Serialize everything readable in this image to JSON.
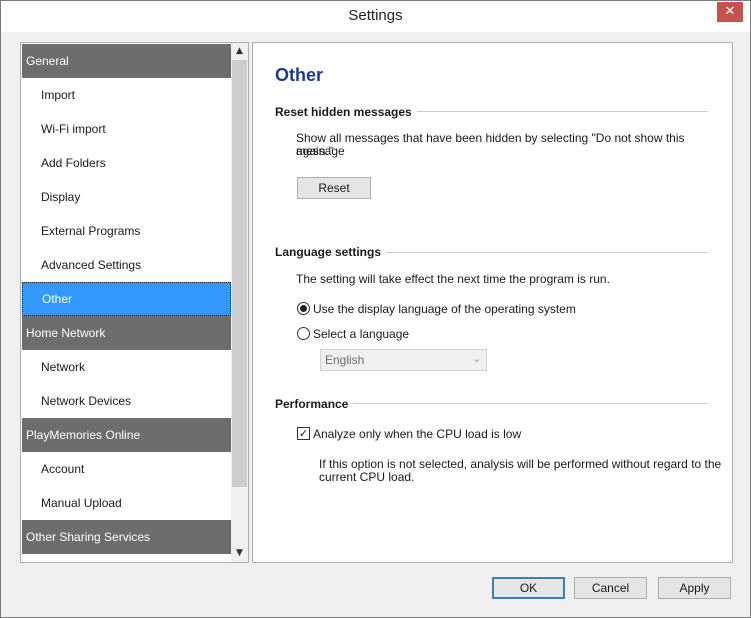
{
  "window": {
    "title": "Settings",
    "close_glyph": "✕"
  },
  "nav": {
    "items": [
      {
        "label": "General",
        "kind": "section"
      },
      {
        "label": "Import",
        "kind": "item"
      },
      {
        "label": "Wi-Fi import",
        "kind": "item"
      },
      {
        "label": "Add Folders",
        "kind": "item"
      },
      {
        "label": "Display",
        "kind": "item"
      },
      {
        "label": "External Programs",
        "kind": "item"
      },
      {
        "label": "Advanced Settings",
        "kind": "item"
      },
      {
        "label": "Other",
        "kind": "selected"
      },
      {
        "label": "Home Network",
        "kind": "section"
      },
      {
        "label": "Network",
        "kind": "item"
      },
      {
        "label": "Network Devices",
        "kind": "item"
      },
      {
        "label": "PlayMemories Online",
        "kind": "section"
      },
      {
        "label": "Account",
        "kind": "item"
      },
      {
        "label": "Manual Upload",
        "kind": "item"
      },
      {
        "label": "Other Sharing Services",
        "kind": "section"
      }
    ],
    "scroll_up_glyph": "▲",
    "scroll_down_glyph": "▼"
  },
  "content": {
    "heading": "Other",
    "reset": {
      "title": "Reset hidden messages",
      "desc_line1": "Show all messages that have been hidden by selecting \"Do not show this message",
      "desc_line2": "again.\"",
      "button": "Reset"
    },
    "language": {
      "title": "Language settings",
      "note": "The setting will take effect the next time the program is run.",
      "option_os": "Use the display language of the operating system",
      "option_select": "Select a language",
      "selected_option": "os",
      "language_value": "English",
      "chevron": "⌄"
    },
    "performance": {
      "title": "Performance",
      "checkbox_label": "Analyze only when the CPU load is low",
      "checked": true,
      "check_glyph": "✓",
      "note_line1": "If this option is not selected, analysis will be performed without regard to the",
      "note_line2": "current CPU load."
    }
  },
  "footer": {
    "ok": "OK",
    "cancel": "Cancel",
    "apply": "Apply"
  },
  "colors": {
    "selected": "#3399ff",
    "section": "#6d6d6d",
    "heading": "#1e3a8a"
  }
}
